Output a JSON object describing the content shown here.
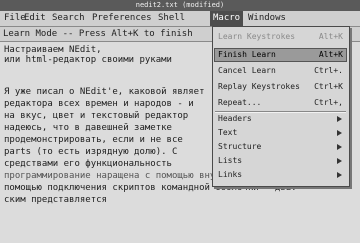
{
  "window": {
    "title": "nedit2.txt (modified)"
  },
  "menubar": [
    "File",
    "Edit",
    "Search",
    "Preferences",
    "Shell",
    "Macro",
    "Windows"
  ],
  "statusline": "Learn Mode -- Press Alt+K to finish",
  "text_lines": [
    "Настраиваем NEdit,",
    "или html-редактор своими руками",
    "",
    "Я уже писал о NEdit'е, каковой являет",
    "редактора всех времен и народов - и",
    "на вкус, цвет и текстовый редактор",
    "надеюсь, что в давешней заметке",
    "продемонстрировать, если и не все",
    "parts (то есть изрядную долю). С",
    "средствами его функциональность",
    "программирование наращена с помощью внутреннего языка макросов",
    "помощью подключения скриптов командной оболочки - два.",
    "ским представляется"
  ],
  "macro_menu": {
    "learn_keystrokes": "Learn Keystrokes",
    "learn_keystrokes_accel": "Alt+K",
    "finish_learn": "Finish Learn",
    "finish_learn_accel": "Alt+K",
    "cancel_learn": "Cancel Learn",
    "cancel_learn_accel": "Ctrl+.",
    "replay_keystrokes": "Replay Keystrokes",
    "replay_keystrokes_accel": "Ctrl+K",
    "repeat": "Repeat...",
    "repeat_accel": "Ctrl+,",
    "submenus": [
      "Headers",
      "Text",
      "Structure",
      "Lists",
      "Links"
    ]
  }
}
